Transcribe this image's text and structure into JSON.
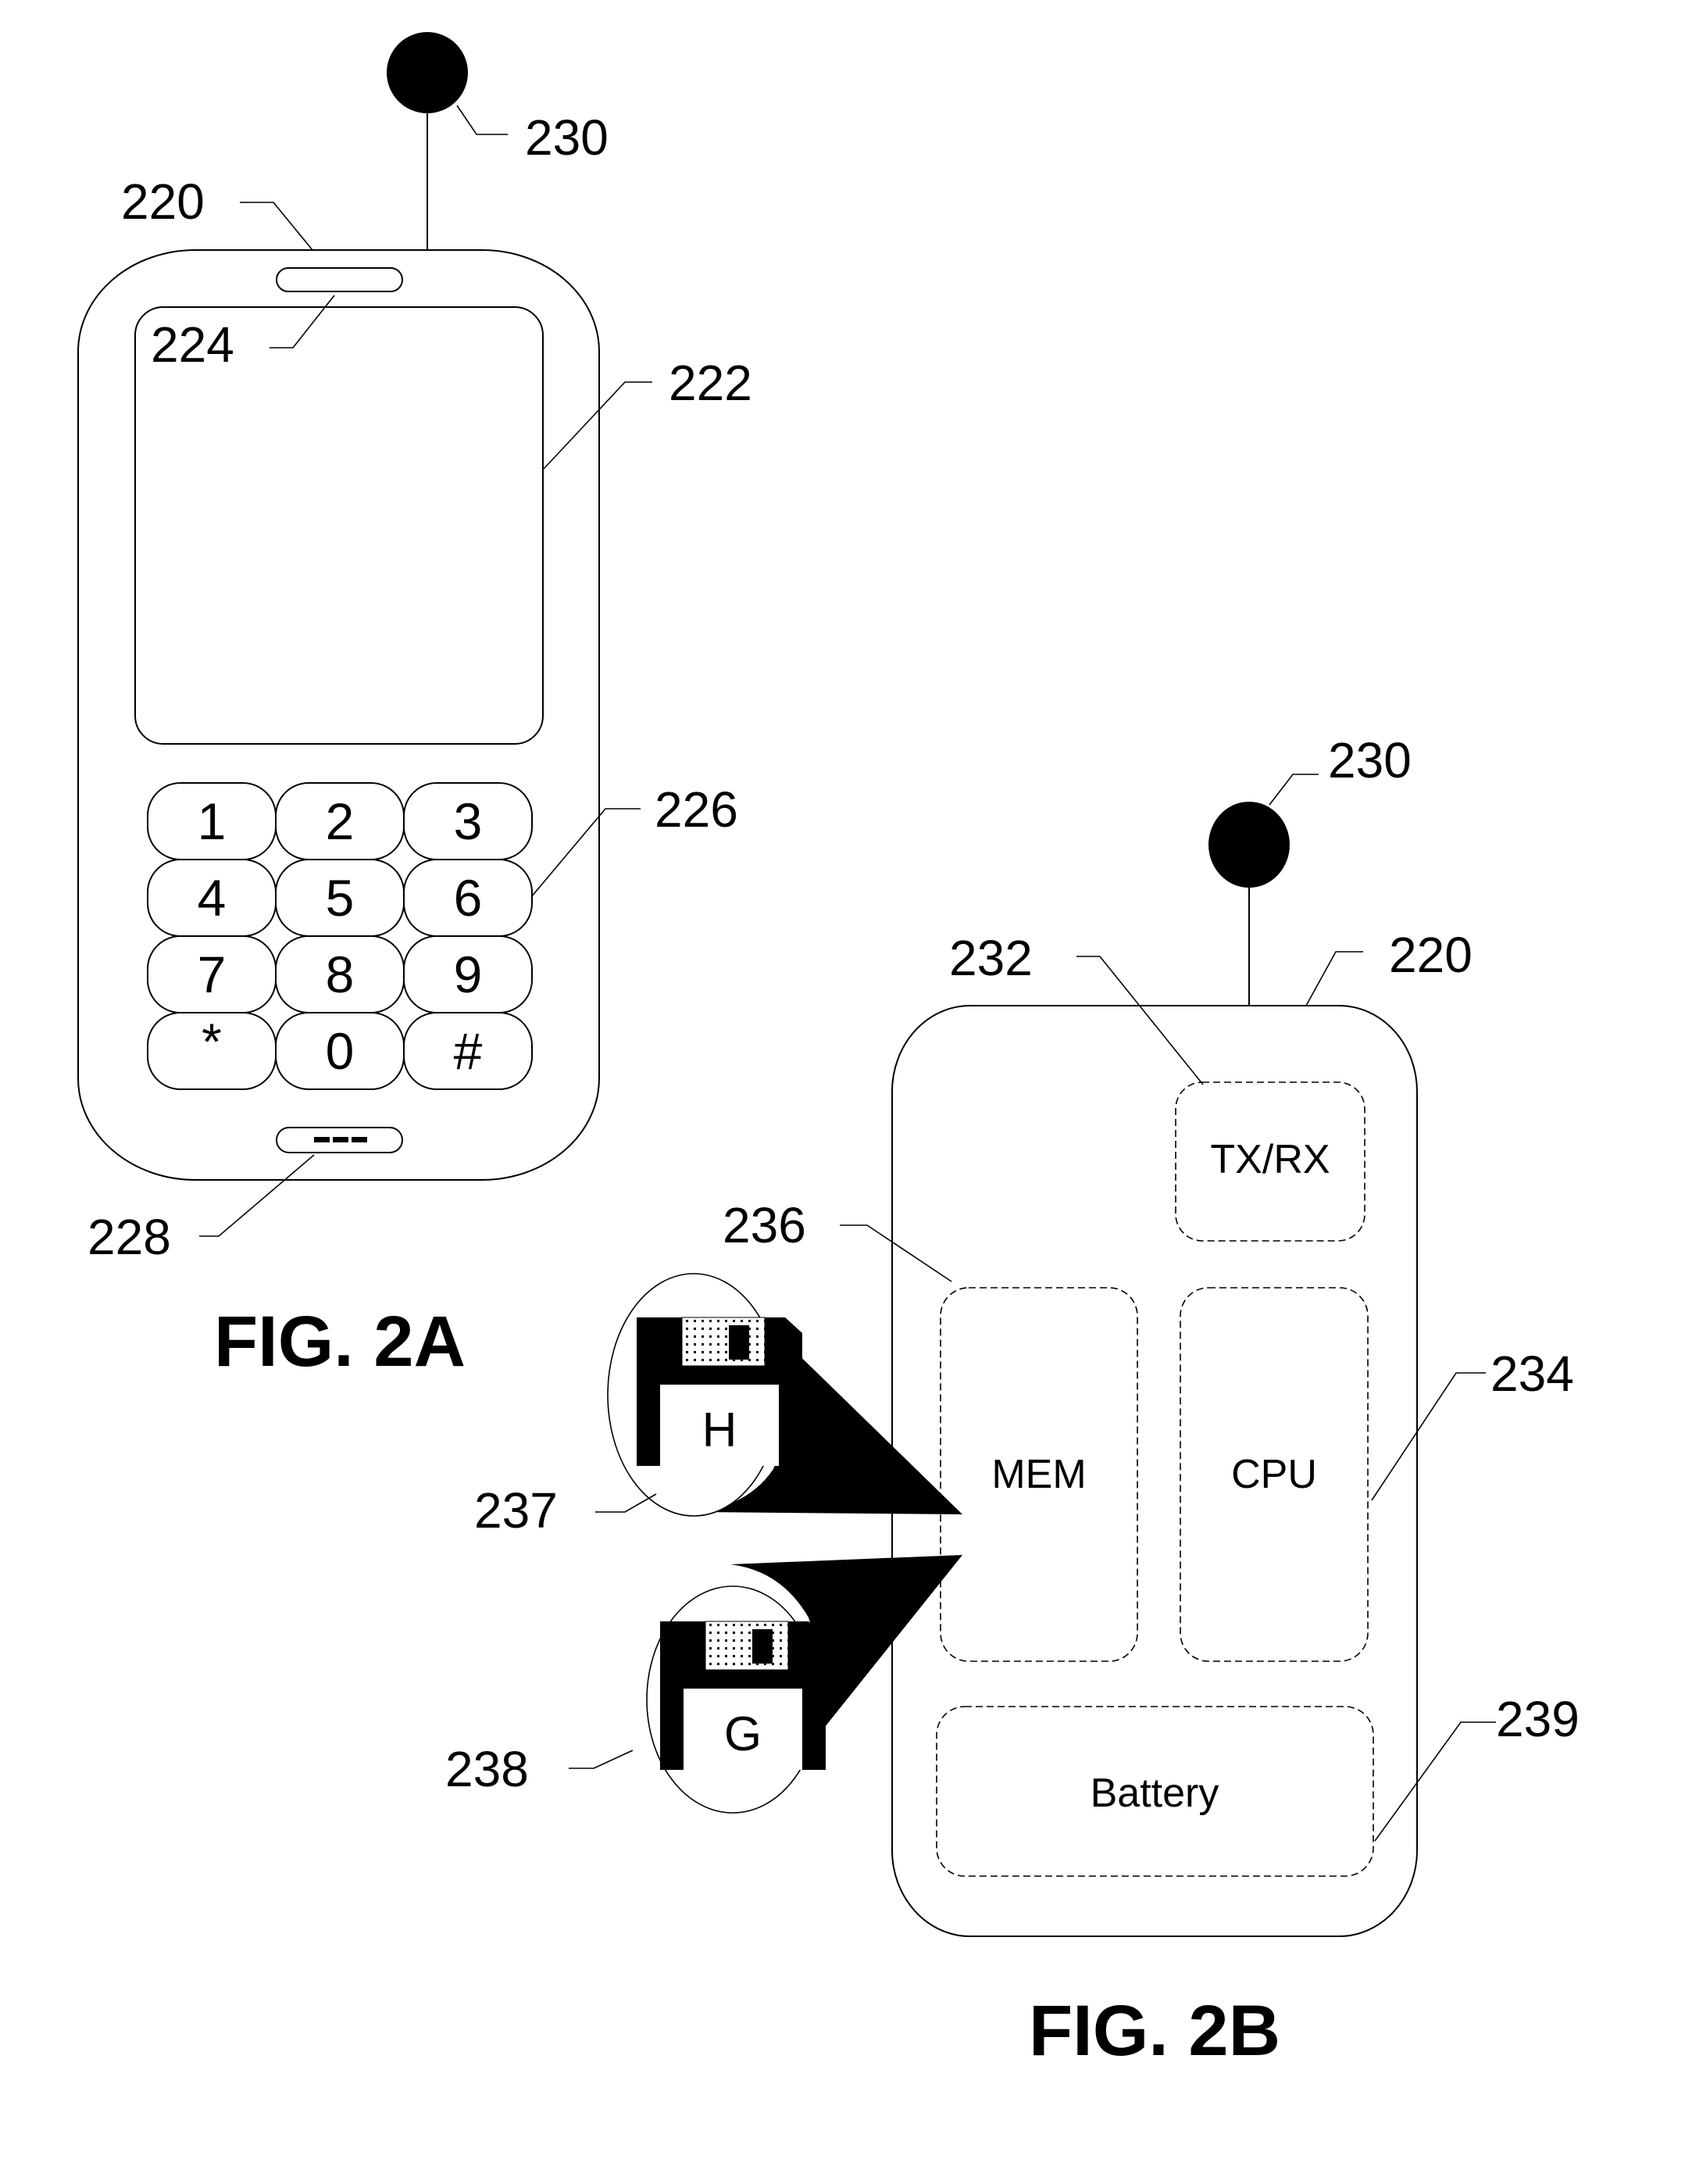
{
  "figures": {
    "fig_2a": {
      "caption": "FIG. 2A",
      "refs": {
        "device": "220",
        "display": "222",
        "speaker": "224",
        "keypad": "226",
        "microphone": "228",
        "antenna": "230"
      },
      "keypad_keys": [
        "1",
        "2",
        "3",
        "4",
        "5",
        "6",
        "7",
        "8",
        "9",
        "*",
        "0",
        "#"
      ],
      "microphone_glyph": "---"
    },
    "fig_2b": {
      "caption": "FIG. 2B",
      "refs": {
        "device": "220",
        "antenna": "230",
        "transceiver": "232",
        "cpu": "234",
        "memory": "236",
        "data_h": "237",
        "data_g": "238",
        "battery": "239"
      },
      "blocks": {
        "transceiver": "TX/RX",
        "memory": "MEM",
        "cpu": "CPU",
        "battery": "Battery"
      },
      "stored_items": [
        {
          "icon": "floppy-disk-icon",
          "letter": "H"
        },
        {
          "icon": "floppy-disk-icon",
          "letter": "G"
        }
      ]
    }
  }
}
